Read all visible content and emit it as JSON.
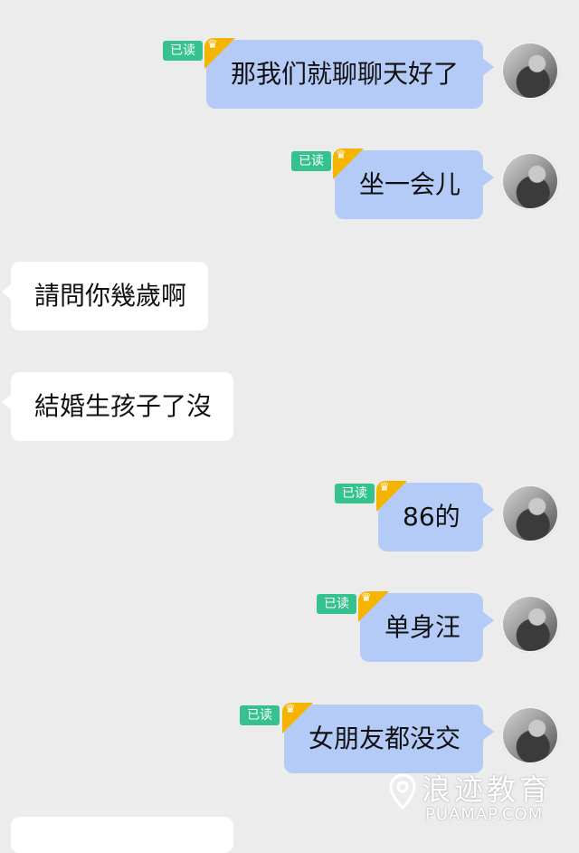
{
  "read_label": "已读",
  "crown_glyph": "♛",
  "messages": [
    {
      "side": "out",
      "text": "那我们就聊聊天好了"
    },
    {
      "side": "out",
      "text": "坐一会儿"
    },
    {
      "side": "in",
      "text": "請問你幾歲啊"
    },
    {
      "side": "in",
      "text": "結婚生孩子了沒"
    },
    {
      "side": "out",
      "text": "86的"
    },
    {
      "side": "out",
      "text": "单身汪"
    },
    {
      "side": "out",
      "text": "女朋友都没交"
    }
  ],
  "watermark": {
    "main": "浪迹教育",
    "sub": "PUAMAP.COM"
  },
  "colors": {
    "background": "#ececec",
    "outgoing_bubble": "#b3cbf6",
    "incoming_bubble": "#ffffff",
    "read_badge": "#36c28f",
    "crown": "#f4b400"
  }
}
